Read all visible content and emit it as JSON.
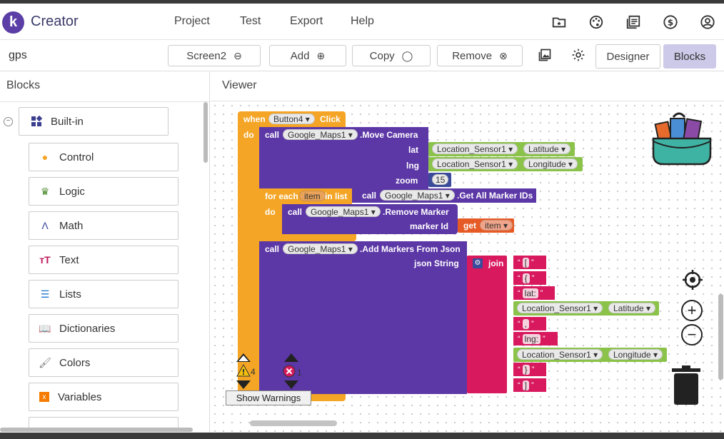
{
  "app": {
    "name": "Creator",
    "logo_letter": "k"
  },
  "menu": [
    "Project",
    "Test",
    "Export",
    "Help"
  ],
  "header_icons": [
    "folder-star-icon",
    "palette-icon",
    "library-icon",
    "dollar-icon",
    "account-icon"
  ],
  "toolbar": {
    "project_name": "gps",
    "screen_label": "Screen2",
    "add_label": "Add",
    "copy_label": "Copy",
    "remove_label": "Remove",
    "designer_label": "Designer",
    "blocks_label": "Blocks"
  },
  "left_panel": {
    "title": "Blocks",
    "builtin_label": "Built-in",
    "categories": [
      {
        "label": "Control",
        "icon": "control-icon",
        "color": "#f4a525"
      },
      {
        "label": "Logic",
        "icon": "logic-icon",
        "color": "#4a8a2a"
      },
      {
        "label": "Math",
        "icon": "math-icon",
        "color": "#3b4a9a"
      },
      {
        "label": "Text",
        "icon": "text-icon",
        "color": "#c2185b"
      },
      {
        "label": "Lists",
        "icon": "lists-icon",
        "color": "#1976d2"
      },
      {
        "label": "Dictionaries",
        "icon": "dictionaries-icon",
        "color": "#283593"
      },
      {
        "label": "Colors",
        "icon": "colors-icon",
        "color": "#777777"
      },
      {
        "label": "Variables",
        "icon": "variables-icon",
        "color": "#f57c00"
      }
    ]
  },
  "viewer": {
    "title": "Viewer"
  },
  "blocks": {
    "when": "when",
    "button": "Button4",
    "click": "Click",
    "do": "do",
    "call": "call",
    "maps": "Google_Maps1",
    "move_camera": ".Move Camera",
    "lat": "lat",
    "lng": "lng",
    "zoom": "zoom",
    "zoom_value": "15",
    "location_sensor": "Location_Sensor1",
    "latitude": "Latitude",
    "longitude": "Longitude",
    "for_each": "for each",
    "item": "item",
    "in_list": "in list",
    "get_all_marker_ids": ".Get All Marker IDs",
    "remove_marker": ".Remove Marker",
    "marker_id": "marker Id",
    "get": "get",
    "add_markers": ".Add Markers From Json",
    "json_string": "json String",
    "join": "join",
    "strings": [
      "[",
      "{",
      "lat:",
      ",",
      "lng:",
      "}",
      "]"
    ]
  },
  "warnings": {
    "warning_count": "4",
    "error_count": "1",
    "show_label": "Show Warnings"
  }
}
